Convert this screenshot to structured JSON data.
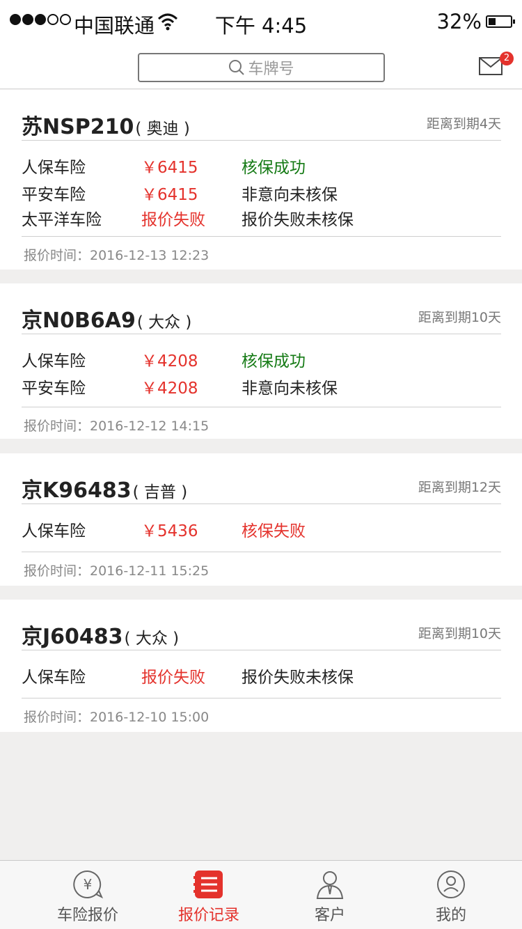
{
  "status_bar": {
    "carrier": "中国联通",
    "time": "下午 4:45",
    "battery": "32%"
  },
  "header": {
    "search_placeholder": "车牌号",
    "mail_badge": "2"
  },
  "records": [
    {
      "plate": "苏NSP210",
      "brand": "( 奥迪 )",
      "expiry": "距离到期4天",
      "quotes": [
        {
          "insurer": "人保车险",
          "price": "￥6415",
          "status": "核保成功",
          "status_type": "success",
          "price_type": "normal"
        },
        {
          "insurer": "平安车险",
          "price": "￥6415",
          "status": "非意向未核保",
          "status_type": "neutral",
          "price_type": "normal"
        },
        {
          "insurer": "太平洋车险",
          "price": "报价失败",
          "status": "报价失败未核保",
          "status_type": "neutral",
          "price_type": "fail"
        }
      ],
      "quote_time": "报价时间：2016-12-13  12:23"
    },
    {
      "plate": "京N0B6A9",
      "brand": "( 大众 )",
      "expiry": "距离到期10天",
      "quotes": [
        {
          "insurer": "人保车险",
          "price": "￥4208",
          "status": "核保成功",
          "status_type": "success",
          "price_type": "normal"
        },
        {
          "insurer": "平安车险",
          "price": "￥4208",
          "status": "非意向未核保",
          "status_type": "neutral",
          "price_type": "normal"
        }
      ],
      "quote_time": "报价时间：2016-12-12  14:15"
    },
    {
      "plate": "京K96483",
      "brand": "( 吉普 )",
      "expiry": "距离到期12天",
      "quotes": [
        {
          "insurer": "人保车险",
          "price": "￥5436",
          "status": "核保失败",
          "status_type": "fail",
          "price_type": "normal"
        }
      ],
      "quote_time": "报价时间：2016-12-11 15:25"
    },
    {
      "plate": "京J60483",
      "brand": "( 大众 )",
      "expiry": "距离到期10天",
      "quotes": [
        {
          "insurer": "人保车险",
          "price": "报价失败",
          "status": "报价失败未核保",
          "status_type": "neutral",
          "price_type": "fail"
        }
      ],
      "quote_time": "报价时间：2016-12-10  15:00"
    }
  ],
  "tabs": [
    {
      "label": "车险报价",
      "icon": "yen-bubble-icon",
      "active": false
    },
    {
      "label": "报价记录",
      "icon": "list-icon",
      "active": true
    },
    {
      "label": "客户",
      "icon": "customer-icon",
      "active": false
    },
    {
      "label": "我的",
      "icon": "profile-icon",
      "active": false
    }
  ],
  "colors": {
    "accent": "#e4322c",
    "success": "#147a14",
    "background": "#f0efee"
  }
}
